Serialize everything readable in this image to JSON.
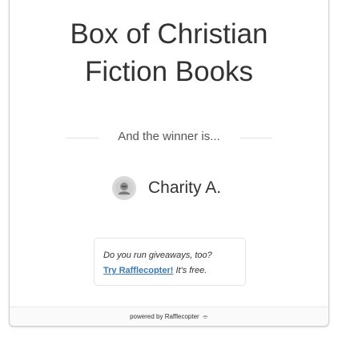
{
  "giveaway": {
    "title_line1": "Box of Christian",
    "title_line2": "Fiction Books"
  },
  "winner": {
    "heading": "And the winner is...",
    "name": "Charity A.",
    "avatar_icon": "user-avatar-icon"
  },
  "promo": {
    "question": "Do you run giveaways, too?",
    "link_label": "Try Rafflecopter!",
    "suffix": " It's free."
  },
  "footer": {
    "powered_by": "powered by Rafflecopter",
    "logo_icon": "rafflecopter-logo-icon"
  },
  "colors": {
    "link": "#3a7ab8",
    "text": "#333333",
    "border": "#cfcfcf"
  }
}
